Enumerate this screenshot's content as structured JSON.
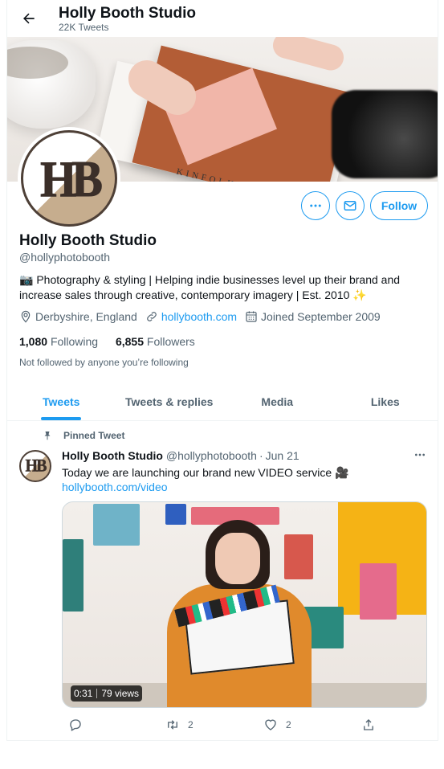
{
  "header": {
    "title": "Holly Booth Studio",
    "tweet_count": "22K Tweets"
  },
  "profile": {
    "avatar_text": "HB",
    "name": "Holly Booth Studio",
    "handle": "@hollyphotobooth",
    "bio_line1": "📷 Photography & styling | Helping indie businesses level up their brand and",
    "bio_line2": "increase sales through creative, contemporary imagery | Est. 2010 ✨",
    "location": "Derbyshire, England",
    "website": "hollybooth.com",
    "joined": "Joined September 2009",
    "following_count": "1,080",
    "following_label": "Following",
    "followers_count": "6,855",
    "followers_label": "Followers",
    "not_followed": "Not followed by anyone you’re following",
    "follow_label": "Follow",
    "accent_color": "#1d9bf0"
  },
  "banner": {
    "magazine_text": "KINFOLK"
  },
  "tabs": [
    {
      "label": "Tweets",
      "active": true
    },
    {
      "label": "Tweets & replies",
      "active": false
    },
    {
      "label": "Media",
      "active": false
    },
    {
      "label": "Likes",
      "active": false
    }
  ],
  "pinned_tweet": {
    "pinned_label": "Pinned Tweet",
    "author_name": "Holly Booth Studio",
    "author_handle": "@hollyphotobooth",
    "date_sep": "·",
    "date": "Jun 21",
    "text": "Today we are launching our brand new VIDEO service 🎥",
    "link": "hollybooth.com/video",
    "video_duration": "0:31",
    "video_views": "79 views",
    "reply_count": "",
    "retweet_count": "2",
    "like_count": "2"
  }
}
